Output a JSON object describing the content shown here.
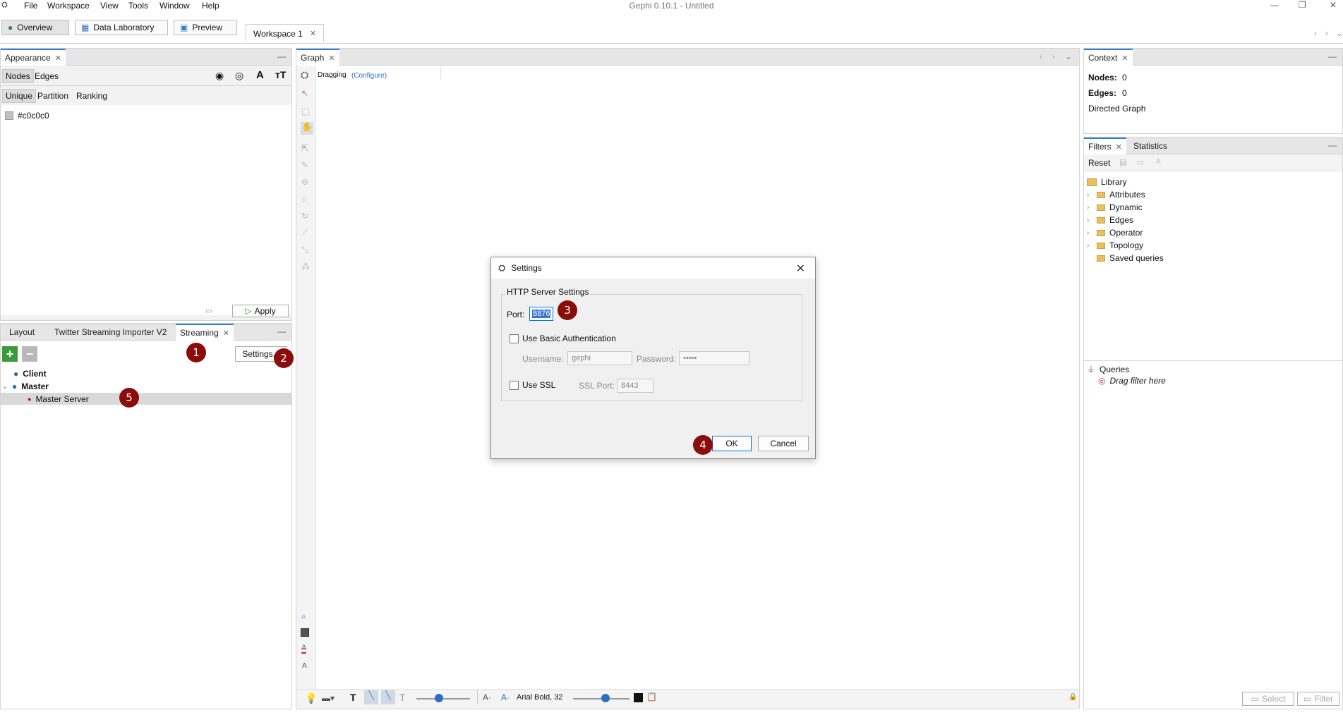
{
  "window": {
    "title": "Gephi 0.10.1 - Untitled",
    "controls": [
      "—",
      "❐",
      "✕"
    ]
  },
  "menu": [
    "File",
    "Workspace",
    "View",
    "Tools",
    "Window",
    "Help"
  ],
  "toolbar": {
    "overview": "Overview",
    "data_lab": "Data Laboratory",
    "preview": "Preview",
    "workspace_tab": "Workspace 1"
  },
  "appearance": {
    "tab": "Appearance",
    "nodes": "Nodes",
    "edges": "Edges",
    "unique": "Unique",
    "partition": "Partition",
    "ranking": "Ranking",
    "color_value": "#c0c0c0",
    "apply": "Apply"
  },
  "lower_left": {
    "tabs": [
      "Layout",
      "Twitter Streaming Importer V2",
      "Streaming"
    ],
    "settings_button": "Settings...",
    "tree": {
      "client": "Client",
      "master": "Master",
      "master_server": "Master Server"
    }
  },
  "graph": {
    "tab": "Graph",
    "mode": "Dragging",
    "configure": "(Configure)",
    "font_label": "Arial Bold, 32"
  },
  "context": {
    "tab": "Context",
    "nodes_label": "Nodes:",
    "nodes_value": "0",
    "edges_label": "Edges:",
    "edges_value": "0",
    "graph_type": "Directed Graph"
  },
  "filters": {
    "tab": "Filters",
    "statistics_tab": "Statistics",
    "reset": "Reset",
    "library": "Library",
    "items": [
      "Attributes",
      "Dynamic",
      "Edges",
      "Operator",
      "Topology",
      "Saved queries"
    ],
    "queries": "Queries",
    "drag_hint": "Drag filter here",
    "select_button": "Select",
    "filter_button": "Filter"
  },
  "dialog": {
    "title": "Settings",
    "group_title": "HTTP Server Settings",
    "port_label": "Port:",
    "port_value": "8876",
    "basic_auth": "Use Basic Authentication",
    "username_label": "Username:",
    "username_value": "gephi",
    "password_label": "Password:",
    "password_value": "•••••",
    "use_ssl": "Use SSL",
    "ssl_port_label": "SSL Port:",
    "ssl_port_value": "8443",
    "ok": "OK",
    "cancel": "Cancel"
  },
  "markers": [
    "1",
    "2",
    "3",
    "4",
    "5"
  ],
  "colors": {
    "marker": "#8b0c0c",
    "accent": "#2b7fd0",
    "node_color": "#c0c0c0"
  }
}
